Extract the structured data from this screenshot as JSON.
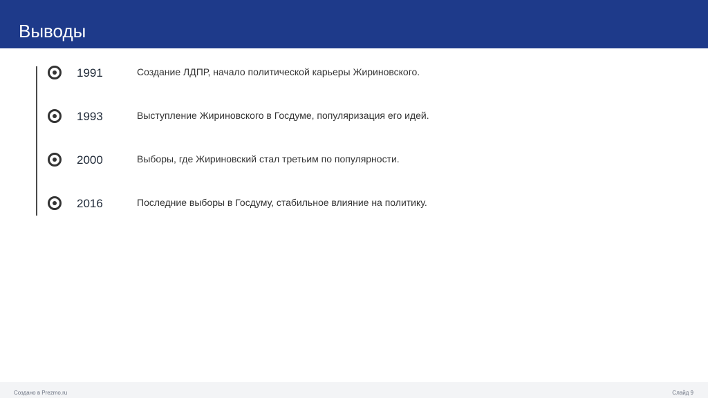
{
  "header": {
    "title": "Выводы"
  },
  "timeline": [
    {
      "year": "1991",
      "text": "Создание ЛДПР, начало политической карьеры Жириновского."
    },
    {
      "year": "1993",
      "text": "Выступление Жириновского в Госдуме, популяризация его идей."
    },
    {
      "year": "2000",
      "text": "Выборы, где Жириновский стал третьим по популярности."
    },
    {
      "year": "2016",
      "text": "Последние выборы в Госдуму, стабильное влияние на политику."
    }
  ],
  "footer": {
    "left": "Создано в Prezmo.ru",
    "right": "Слайд 9"
  },
  "colors": {
    "header_bg": "#1e3a8a",
    "header_text": "#ffffff",
    "marker": "#333333",
    "footer_bg": "#f3f4f6"
  }
}
